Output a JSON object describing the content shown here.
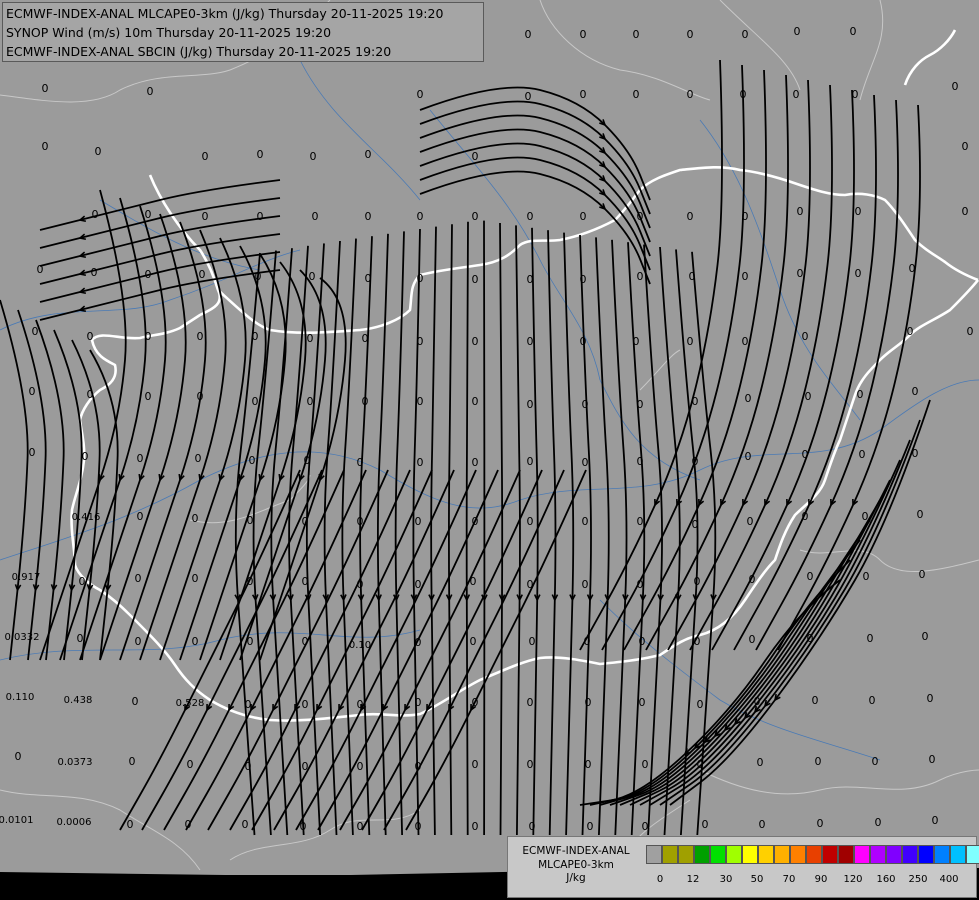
{
  "title": {
    "lines": [
      "ECMWF-INDEX-ANAL MLCAPE0-3km (J/kg) Thursday 20-11-2025 19:20",
      "SYNOP Wind (m/s) 10m Thursday 20-11-2025 19:20",
      "ECMWF-INDEX-ANAL SBCIN (J/kg) Thursday 20-11-2025 19:20"
    ]
  },
  "legend": {
    "title_lines": [
      "ECMWF-INDEX-ANAL",
      "MLCAPE0-3km",
      "J/kg"
    ],
    "tick_labels": [
      "0",
      "12",
      "30",
      "50",
      "70",
      "90",
      "120",
      "160",
      "250",
      "400"
    ],
    "swatch_colors": [
      "#a0a0a0",
      "#a0a000",
      "#a0a000",
      "#00a000",
      "#00e000",
      "#a0ff00",
      "#ffff00",
      "#ffd000",
      "#ffb000",
      "#ff8000",
      "#e84000",
      "#c00000",
      "#a00000",
      "#ff00ff",
      "#b000ff",
      "#8000ff",
      "#4000ff",
      "#0000ff",
      "#0080ff",
      "#00c0ff",
      "#80ffff",
      "#ffffff"
    ]
  },
  "colors": {
    "background": "#9b9b9b",
    "streamline": "#000000",
    "country_border": "#ffffff",
    "region_border": "#c8c8c8",
    "river": "#4a7ab5"
  },
  "map_values": [
    {
      "t": "0"
    },
    {
      "t": "0"
    },
    {
      "t": "0"
    },
    {
      "t": "0"
    },
    {
      "t": "0"
    },
    {
      "t": "0"
    },
    {
      "t": "0"
    },
    {
      "t": "0"
    },
    {
      "t": "0"
    },
    {
      "t": "0"
    },
    {
      "t": "0"
    },
    {
      "t": "0"
    },
    {
      "t": "0"
    },
    {
      "t": "0"
    },
    {
      "t": "0"
    },
    {
      "t": "0"
    },
    {
      "t": "0"
    },
    {
      "t": "0"
    },
    {
      "t": "0"
    },
    {
      "t": "0"
    },
    {
      "t": "0"
    },
    {
      "t": "0"
    },
    {
      "t": "0"
    },
    {
      "t": "0"
    },
    {
      "t": "0.416"
    },
    {
      "t": "0.917"
    },
    {
      "t": "0.0332"
    },
    {
      "t": "0.110"
    },
    {
      "t": "0.438"
    },
    {
      "t": "0.528"
    },
    {
      "t": "0.0373"
    },
    {
      "t": "0.0101"
    },
    {
      "t": "0.0006"
    },
    {
      "t": "0.10"
    }
  ]
}
